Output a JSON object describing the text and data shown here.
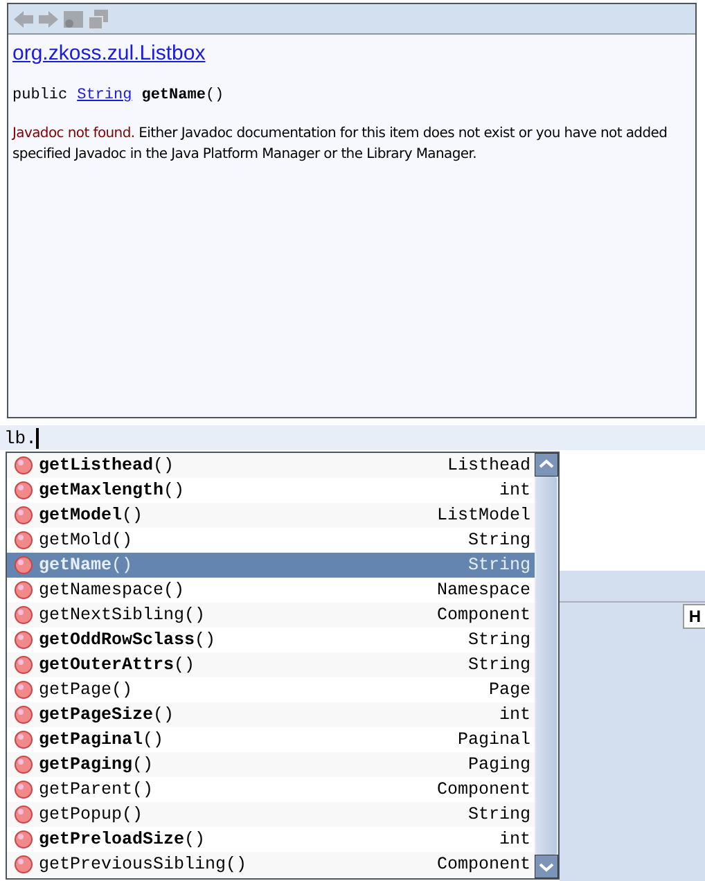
{
  "doc_popup": {
    "toolbar": [
      {
        "kind": "back",
        "disabled": true
      },
      {
        "kind": "forward",
        "disabled": true
      },
      {
        "kind": "source",
        "disabled": true
      },
      {
        "kind": "external",
        "disabled": true
      }
    ],
    "class_link": "org.zkoss.zul.Listbox",
    "signature": {
      "modifier": "public",
      "type": "String",
      "name": "**getName**()"
    },
    "notice": "Javadoc not found.",
    "message": " Either Javadoc documentation for this item does not exist or you have not added specified Javadoc in the Java Platform Manager or the Library Manager."
  },
  "editor": {
    "line": "lb."
  },
  "side_tab": "H",
  "completion": [
    {
      "signature": "**getListhead**()",
      "type": "Listhead",
      "selected": false
    },
    {
      "signature": "**getMaxlength**()",
      "type": "int",
      "selected": false
    },
    {
      "signature": "**getModel**()",
      "type": "ListModel",
      "selected": false
    },
    {
      "signature": "getMold()",
      "type": "String",
      "selected": false
    },
    {
      "signature": "**getName**()",
      "type": "String",
      "selected": true
    },
    {
      "signature": "getNamespace()",
      "type": "Namespace",
      "selected": false
    },
    {
      "signature": "getNextSibling()",
      "type": "Component",
      "selected": false
    },
    {
      "signature": "**getOddRowSclass**()",
      "type": "String",
      "selected": false
    },
    {
      "signature": "**getOuterAttrs**()",
      "type": "String",
      "selected": false
    },
    {
      "signature": "getPage()",
      "type": "Page",
      "selected": false
    },
    {
      "signature": "**getPageSize**()",
      "type": "int",
      "selected": false
    },
    {
      "signature": "**getPaginal**()",
      "type": "Paginal",
      "selected": false
    },
    {
      "signature": "**getPaging**()",
      "type": "Paging",
      "selected": false
    },
    {
      "signature": "getParent()",
      "type": "Component",
      "selected": false
    },
    {
      "signature": "getPopup()",
      "type": "String",
      "selected": false
    },
    {
      "signature": "**getPreloadSize**()",
      "type": "int",
      "selected": false
    },
    {
      "signature": "getPreviousSibling()",
      "type": "Component",
      "selected": false
    }
  ]
}
